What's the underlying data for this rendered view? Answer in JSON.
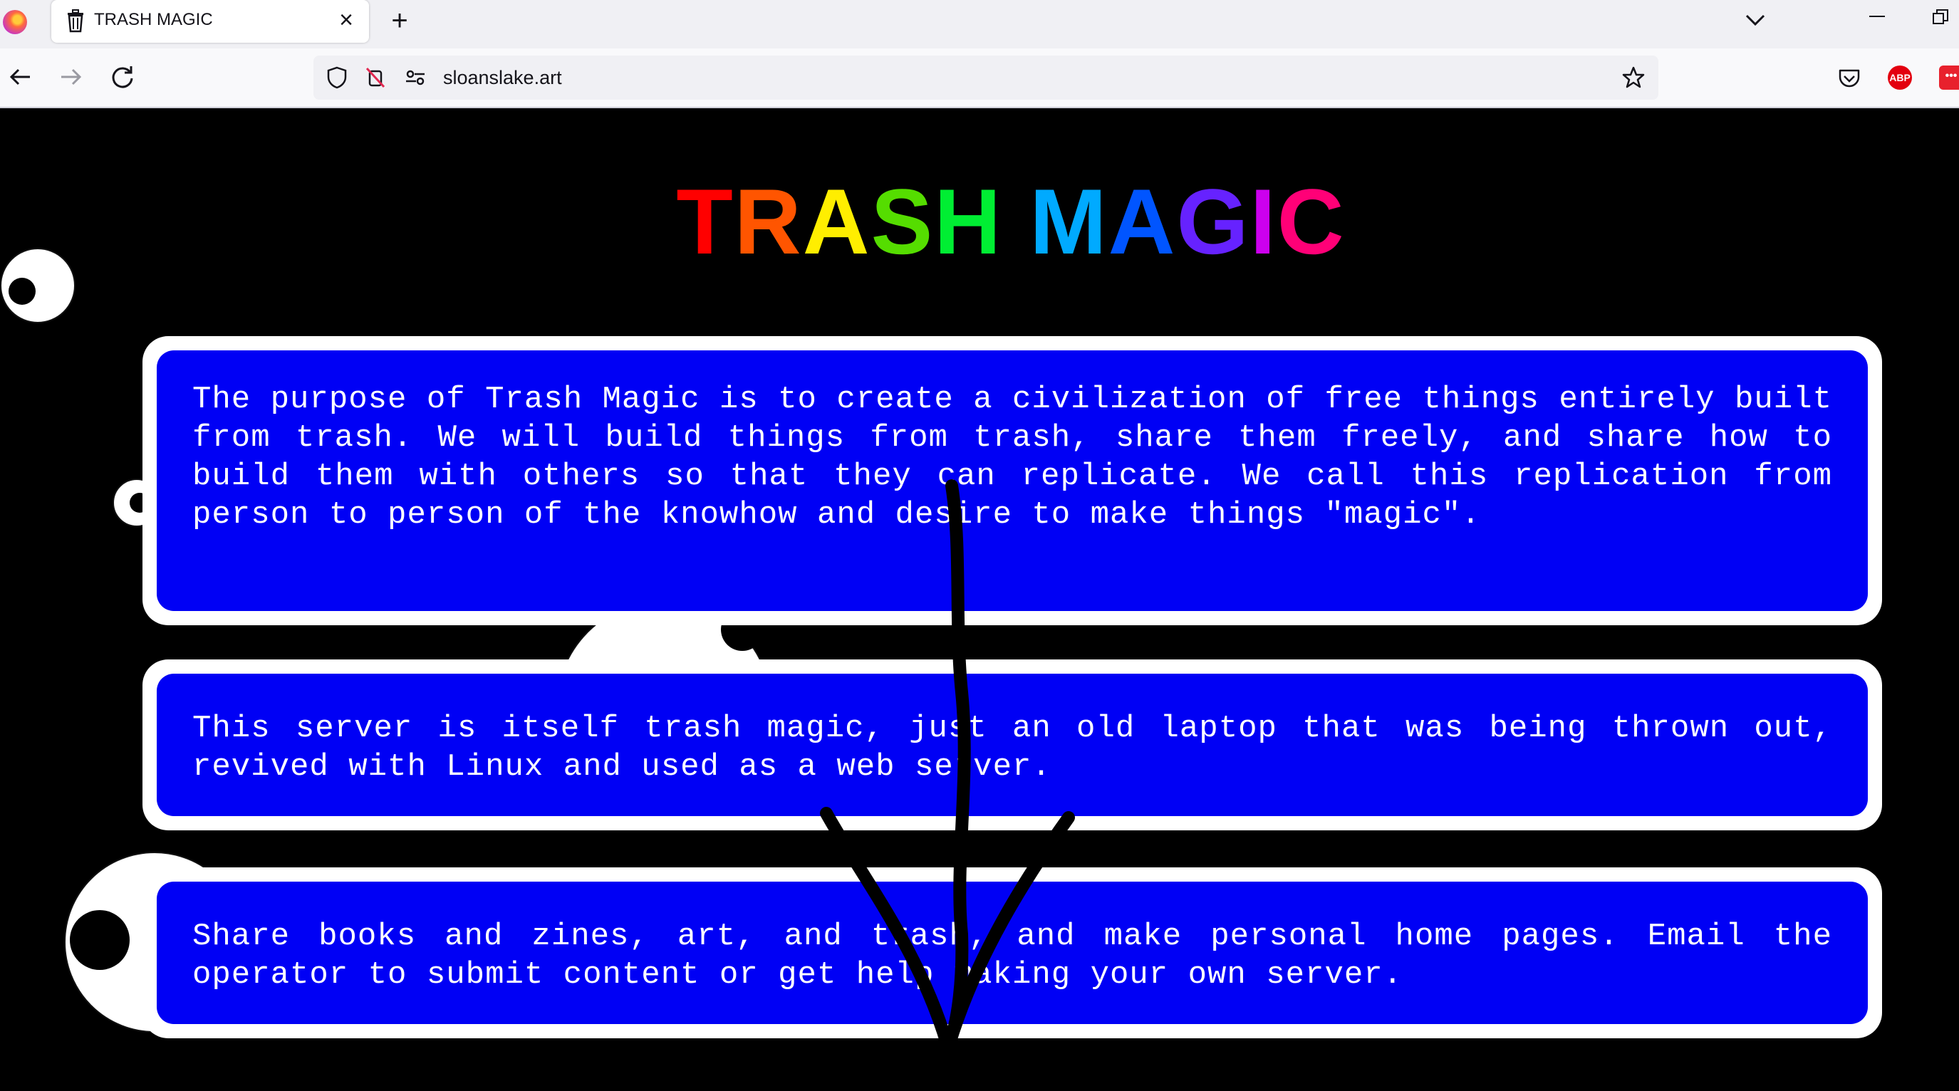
{
  "browser": {
    "tab": {
      "title": "TRASH MAGIC",
      "close_glyph": "×"
    },
    "new_tab_glyph": "+",
    "url": "sloanslake.art",
    "abp_label": "ABP",
    "ext_label": "•••"
  },
  "page": {
    "title_letters": [
      {
        "char": "T",
        "color": "#ff0000"
      },
      {
        "char": "R",
        "color": "#ff5500"
      },
      {
        "char": "A",
        "color": "#ffee00"
      },
      {
        "char": "S",
        "color": "#55dd00"
      },
      {
        "char": "H",
        "color": "#00ee33"
      },
      {
        "char": " ",
        "color": "#000000"
      },
      {
        "char": "M",
        "color": "#00aaff"
      },
      {
        "char": "A",
        "color": "#0055ff"
      },
      {
        "char": "G",
        "color": "#6622ff"
      },
      {
        "char": "I",
        "color": "#cc00ee"
      },
      {
        "char": "C",
        "color": "#ff0077"
      }
    ],
    "paragraphs": [
      "The purpose of Trash Magic is to create a civilization of free things entirely built from trash. We will build things from trash, share them freely, and share how to build them with others so that they can replicate. We call this replication from person to person of the knowhow and desire to make things \"magic\".",
      "This server is itself trash magic, just an old laptop that was being thrown out, revived with Linux and used as a web server.",
      "Share books and zines, art, and trash, and make personal home pages. Email the operator to submit content or get help making your own server."
    ]
  },
  "colors": {
    "page_background": "#000000",
    "card_border": "#ffffff",
    "card_fill": "#0000f5",
    "card_text": "#ffffff"
  },
  "icons": [
    "firefox-icon",
    "trash-icon",
    "close-icon",
    "plus-icon",
    "chevron-down-icon",
    "minimize-icon",
    "restore-icon",
    "back-arrow-icon",
    "forward-arrow-icon",
    "reload-icon",
    "shield-icon",
    "blocked-permission-icon",
    "site-settings-icon",
    "star-icon",
    "pocket-icon",
    "adblock-icon",
    "extension-icon"
  ]
}
